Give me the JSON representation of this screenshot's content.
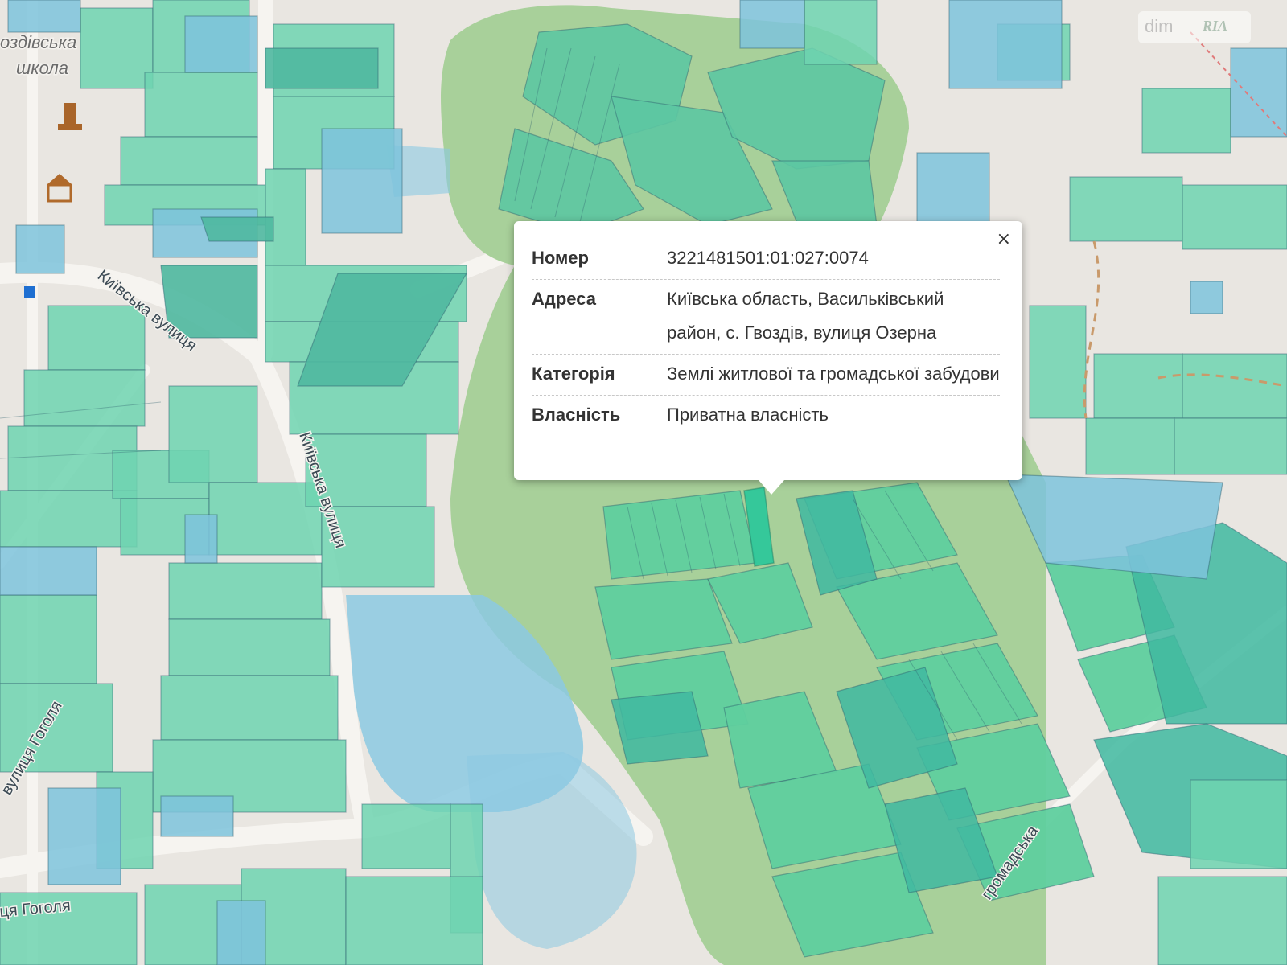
{
  "map": {
    "streets": [
      "Київська вулиця",
      "Київська вулиця",
      "вулиця Гоголя",
      "ця Гоголя",
      "громадська"
    ],
    "places": [
      "оздівська",
      "школа"
    ],
    "colors": {
      "background": "#e9e6e1",
      "forest": "#a8d09a",
      "parcel_green": "#6fd3b0",
      "parcel_blue": "#7ec3dc",
      "parcel_dark": "#3fb8a0",
      "water": "#8cc9e2",
      "highlight": "#2ec79a"
    },
    "icons": [
      "monument-icon",
      "museum-icon",
      "bus-stop-icon"
    ]
  },
  "popup": {
    "close": "×",
    "rows": [
      {
        "label": "Номер",
        "value": "3221481501:01:027:0074"
      },
      {
        "label": "Адреса",
        "value": "Київська область, Васильківський район, с. Гвоздів, вулиця Озерна"
      },
      {
        "label": "Категорія",
        "value": "Землі житлової та громадської забудови"
      },
      {
        "label": "Власність",
        "value": "Приватна власність"
      }
    ]
  },
  "watermark": {
    "brand": "dim",
    "brand2": "RIA"
  }
}
